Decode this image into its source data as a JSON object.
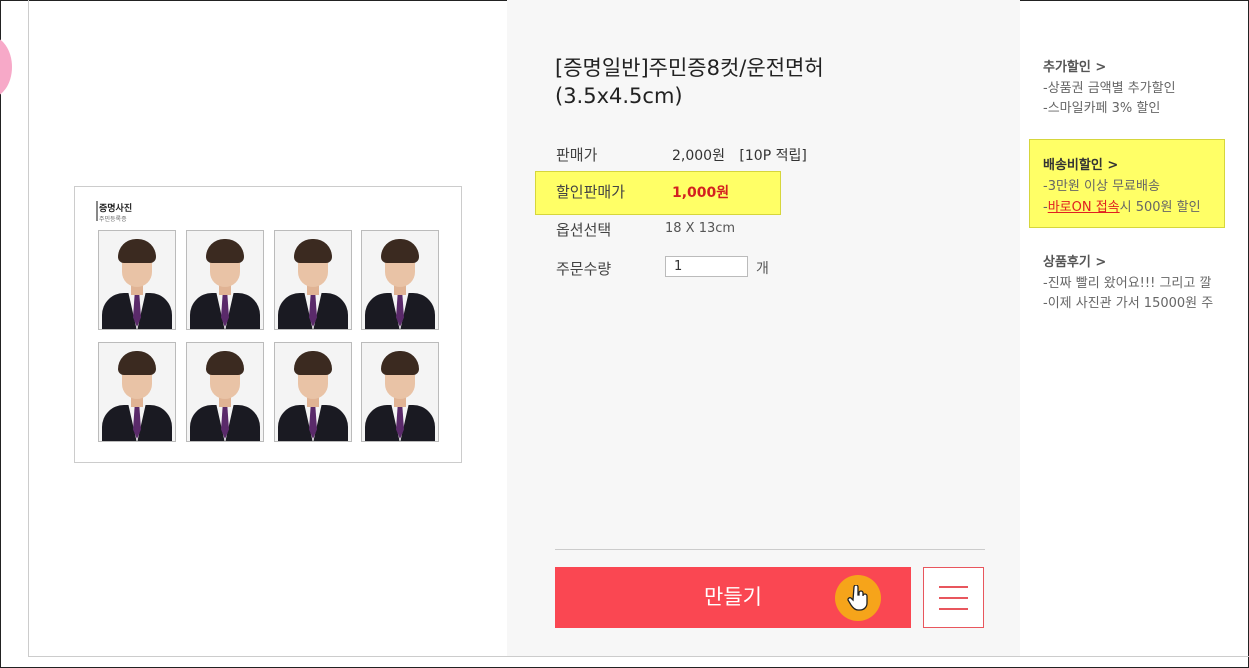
{
  "product": {
    "title_line1": "[증명일반]주민증8컷/운전면허",
    "title_line2": "(3.5x4.5cm)",
    "price_label": "판매가",
    "price_value": "2,000원",
    "points": "[10P 적립]",
    "discount_label": "할인판매가",
    "discount_value": "1,000원",
    "option_label": "옵션선택",
    "option_value": "18 X 13cm",
    "qty_label": "주문수량",
    "qty_value": "1",
    "qty_unit": "개"
  },
  "preview": {
    "sheet_title": "증명사진",
    "sheet_subtitle": "주민등록증"
  },
  "actions": {
    "make_label": "만들기"
  },
  "sidebar": {
    "extra_discount": {
      "heading": "추가할인 >",
      "lines": [
        "-상품권 금액별 추가할인",
        "-스마일카페 3% 할인"
      ]
    },
    "shipping_discount": {
      "heading": "배송비할인 >",
      "line1": "-3만원 이상 무료배송",
      "line2_prefix": "-",
      "line2_link": "바로ON 접속",
      "line2_suffix": "시 500원 할인"
    },
    "reviews": {
      "heading": "상품후기 >",
      "lines": [
        "-진짜 빨리 왔어요!!! 그리고 깔",
        "-이제 사진관 가서 15000원 주"
      ]
    }
  },
  "colors": {
    "accent": "#fa4752",
    "highlight": "#ffff66",
    "discount_price": "#d32020",
    "cursor_badge": "#f6a41a"
  }
}
